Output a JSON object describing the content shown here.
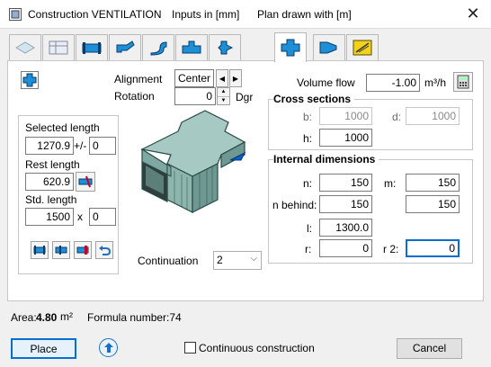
{
  "window": {
    "title_app": "Construction VENTILATION",
    "title_inputs": "Inputs in [mm]",
    "title_plan": "Plan drawn with  [m]",
    "close_glyph": "✕"
  },
  "tabs": [
    "cut-body",
    "table",
    "straight-duct",
    "bend",
    "s-bend",
    "tee-piece",
    "transition",
    "cross-piece",
    "reducer",
    "accessory"
  ],
  "alignment": {
    "label": "Alignment",
    "value": "Center"
  },
  "rotation": {
    "label": "Rotation",
    "value": "0",
    "unit": "Dgr"
  },
  "volume_flow": {
    "label": "Volume flow",
    "value": "-1.00",
    "unit": "m³/h"
  },
  "lengths": {
    "selected_label": "Selected length",
    "selected_value": "1270.9",
    "tolerance_label": "+/-",
    "tolerance_value": "0",
    "rest_label": "Rest length",
    "rest_value": "620.9",
    "std_label": "Std. length",
    "std_value": "1500",
    "multiply_label": "x",
    "multiply_value": "0"
  },
  "cross_sections": {
    "title": "Cross sections",
    "b_label": "b:",
    "b_value": "1000",
    "d_label": "d:",
    "d_value": "1000",
    "h_label": "h:",
    "h_value": "1000"
  },
  "internal": {
    "title": "Internal dimensions",
    "n_label": "n:",
    "n_value": "150",
    "m_label": "m:",
    "m_value": "150",
    "n_behind_label": "n behind:",
    "n_behind_value": "150",
    "n_behind_right_value": "150",
    "l_label": "l:",
    "l_value": "1300.0",
    "r_label": "r:",
    "r_value": "0",
    "r2_label": "r 2:",
    "r2_value": "0"
  },
  "continuation": {
    "label": "Continuation",
    "value": "2"
  },
  "footer": {
    "area_label": "Area:",
    "area_value": "4.80",
    "area_unit": "m²",
    "formula": "Formula number:74",
    "place": "Place",
    "continuous": "Continuous construction",
    "cancel": "Cancel"
  },
  "colors": {
    "accent": "#0a6ed1",
    "duct_fill": "#a7c9c4",
    "duct_dark": "#2a4a48",
    "icon_blue": "#1c8fd6"
  }
}
